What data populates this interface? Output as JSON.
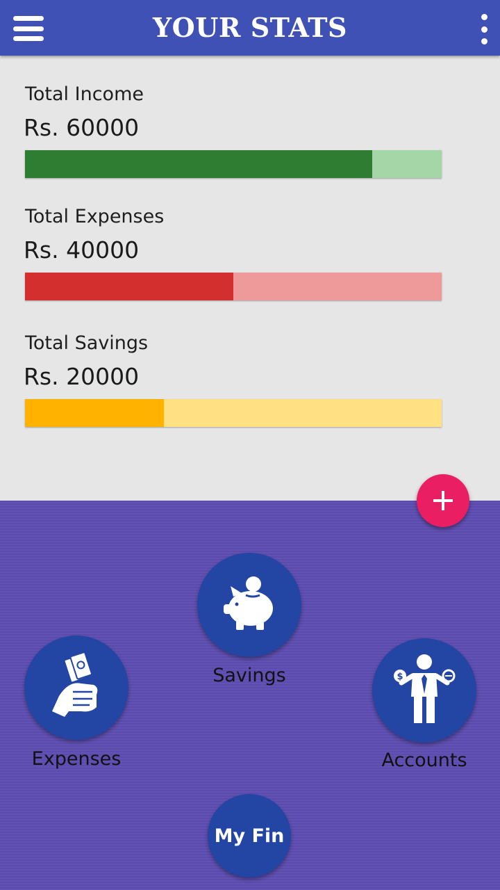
{
  "header": {
    "title": "YOUR STATS"
  },
  "stats": [
    {
      "label": "Total Income",
      "value": "Rs. 60000",
      "fill_percent": 83.3
    },
    {
      "label": "Total Expenses",
      "value": "Rs. 40000",
      "fill_percent": 50
    },
    {
      "label": "Total Savings",
      "value": "Rs. 20000",
      "fill_percent": 33.3
    }
  ],
  "colors": {
    "appbar": "#3f51b5",
    "income": "#2e7d32",
    "expenses": "#d32f2f",
    "savings": "#ffb300",
    "fab": "#e91e63",
    "panel": "#5e4db2",
    "circle_button": "#2345a3"
  },
  "icons": {
    "menu": "hamburger-icon",
    "overflow": "kebab-menu-icon",
    "fab": "plus-icon",
    "savings": "piggy-bank-icon",
    "expenses": "hand-money-icon",
    "accounts": "businessman-icon"
  },
  "nav": {
    "savings_label": "Savings",
    "expenses_label": "Expenses",
    "accounts_label": "Accounts",
    "myfin_label": "My Fin"
  }
}
